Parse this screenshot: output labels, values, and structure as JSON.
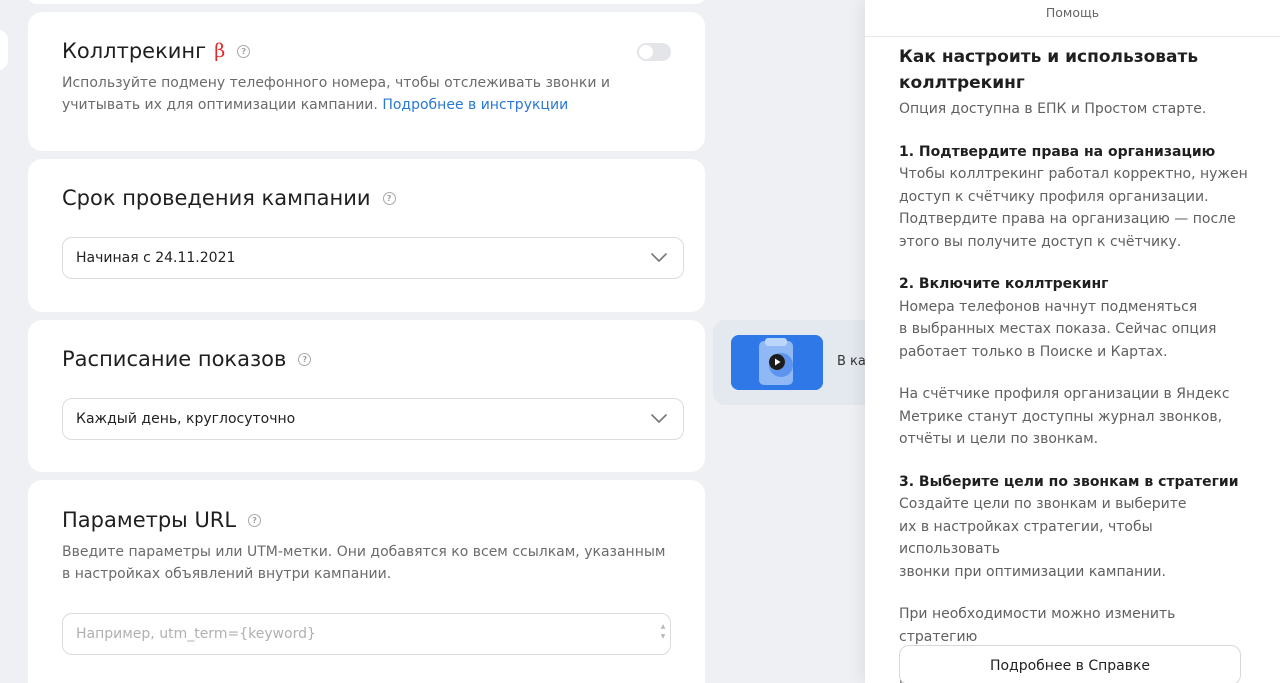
{
  "calltracking": {
    "title": "Коллтрекинг",
    "beta": "β",
    "description": "Используйте подмену телефонного номера, чтобы отслеживать звонки и учитывать их для оптимизации кампании.",
    "link": "Подробнее в инструкции",
    "enabled": false
  },
  "period": {
    "title": "Срок проведения кампании",
    "value": "Начиная с 24.11.2021"
  },
  "schedule": {
    "title": "Расписание показов",
    "value": "Каждый день, круглосуточно"
  },
  "url_params": {
    "title": "Параметры URL",
    "description": "Введите параметры или UTM-метки. Они добавятся ко всем ссылкам, указанным\nв настройках объявлений внутри кампании.",
    "placeholder": "Например, utm_term={keyword}"
  },
  "promo": {
    "text": "В ка"
  },
  "help": {
    "header": "Помощь",
    "title": "Как настроить и использовать коллтрекинг",
    "subtitle": "Опция доступна в ЕПК и Простом старте.",
    "sections": [
      {
        "title": "1. Подтвердите права на организацию",
        "text": "Чтобы коллтрекинг работал корректно, нужен\nдоступ к счётчику профиля организации.\nПодтвердите права на организацию — после\nэтого вы получите доступ к счётчику."
      },
      {
        "title": "2. Включите коллтрекинг",
        "text": "Номера телефонов начнут подменяться\nв выбранных местах показа. Сейчас опция\nработает только в Поиске и Картах."
      },
      {
        "title": "",
        "text": "На счётчике профиля организации в Яндекс\nМетрике станут доступны журнал звонков,\nотчёты и цели по звонкам."
      },
      {
        "title": "3. Выберите цели по звонкам в стратегии",
        "text": "Создайте цели по звонкам и выберите\nих в настройках стратегии, чтобы использовать\nзвонки при оптимизации кампании."
      },
      {
        "title": "",
        "text": "При необходимости можно изменить стратегию\nи настроить оплату за достижение этих целей."
      }
    ],
    "button": "Подробнее в Справке"
  }
}
